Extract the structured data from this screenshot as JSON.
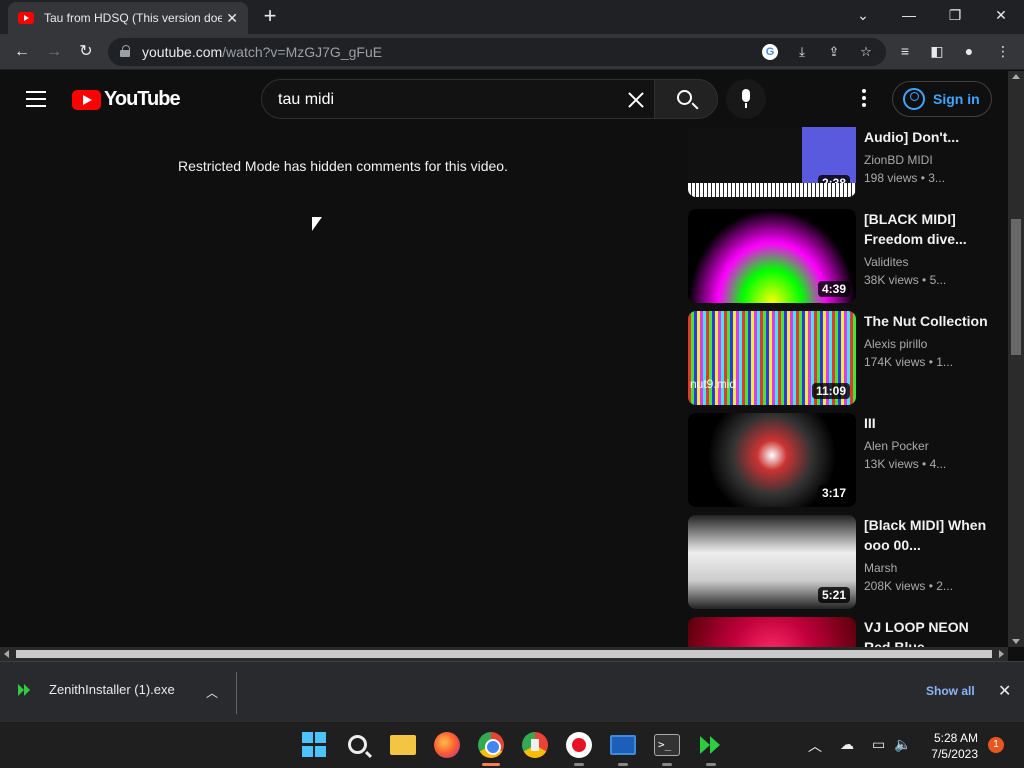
{
  "browser": {
    "tab_title": "Tau from HDSQ (This version does",
    "url_host": "youtube.com",
    "url_path": "/watch?v=MzGJ7G_gFuE"
  },
  "youtube": {
    "logo_text": "YouTube",
    "search_query": "tau midi",
    "sign_in_label": "Sign in",
    "restricted_notice": "Restricted Mode has hidden comments for this video."
  },
  "recommendations": [
    {
      "title": "Audio] Don't...",
      "channel": "ZionBD MIDI",
      "views": "198 views",
      "age": "• 3...",
      "duration": "2:38",
      "thumb": "piano-roll"
    },
    {
      "title": "[BLACK MIDI] Freedom dive...",
      "channel": "Validites",
      "views": "38K views",
      "age": "• 5...",
      "duration": "4:39",
      "thumb": "rainbow-lines"
    },
    {
      "title": "The Nut Collection",
      "channel": "Alexis pirillo",
      "views": "174K views",
      "age": "• 1...",
      "duration": "11:09",
      "thumb": "colored-stripes",
      "overlay": "nut9.mid"
    },
    {
      "title": "III",
      "channel": "Alen Pocker",
      "views": "13K views",
      "age": "• 4...",
      "duration": "3:17",
      "thumb": "red-tunnel"
    },
    {
      "title": "[Black MIDI] When ooo 00...",
      "channel": "Marsh",
      "views": "208K views",
      "age": "• 2...",
      "duration": "5:21",
      "thumb": "grey-wave"
    },
    {
      "title": "VJ LOOP NEON Red Blue",
      "channel": "",
      "views": "",
      "age": "",
      "duration": "",
      "thumb": "neon"
    }
  ],
  "downloads": {
    "file_name": "ZenithInstaller (1).exe",
    "show_all_label": "Show all"
  },
  "taskbar": {
    "time": "5:28 AM",
    "date": "7/5/2023",
    "notification_count": "1"
  }
}
